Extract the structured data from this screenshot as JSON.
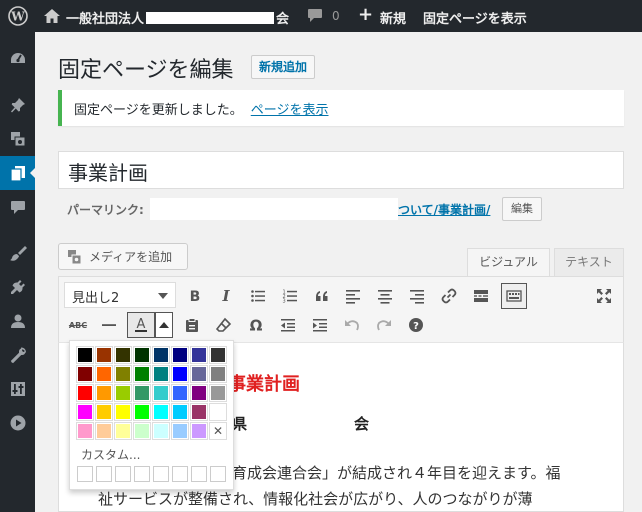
{
  "adminbar": {
    "site_prefix": "一般社団法人",
    "site_suffix": "会",
    "comment_count": "0",
    "new_label": "新規",
    "view_label": "固定ページを表示"
  },
  "page": {
    "title": "固定ページを編集",
    "add_new": "新規追加"
  },
  "notice": {
    "text": "固定ページを更新しました。",
    "link": "ページを表示"
  },
  "post": {
    "title": "事業計画",
    "permalink_label": "パーマリンク:",
    "permalink_tail": "ついて/事業計画/",
    "edit_button": "編集"
  },
  "editor": {
    "media_button": "メディアを追加",
    "tab_visual": "ビジュアル",
    "tab_text": "テキスト",
    "format_select": "見出し2",
    "strikethrough_label": "ABC"
  },
  "colors": {
    "accent": "#0073aa",
    "adminbar": "#23282d",
    "notice_success": "#46b450",
    "heading_red": "#e02020"
  },
  "content": {
    "heading": "事業計画",
    "sub1": "県",
    "sub2": "会",
    "line1": "育成会連合会」が結成され４年目を迎えます。福",
    "line2": "祉サービスが整備され、情報化社会が広がり、人のつながりが薄"
  },
  "color_picker": {
    "custom_label": "カスタム...",
    "clear_symbol": "✕",
    "swatches": [
      [
        "#000000",
        "#993300",
        "#333300",
        "#003300",
        "#003366",
        "#000080",
        "#333399",
        "#333333"
      ],
      [
        "#800000",
        "#FF6600",
        "#808000",
        "#008000",
        "#008080",
        "#0000FF",
        "#666699",
        "#808080"
      ],
      [
        "#FF0000",
        "#FF9900",
        "#99CC00",
        "#339966",
        "#33CCCC",
        "#3366FF",
        "#800080",
        "#999999"
      ],
      [
        "#FF00FF",
        "#FFCC00",
        "#FFFF00",
        "#00FF00",
        "#00FFFF",
        "#00CCFF",
        "#993366",
        "#FFFFFF"
      ],
      [
        "#FF99CC",
        "#FFCC99",
        "#FFFF99",
        "#CCFFCC",
        "#CCFFFF",
        "#99CCFF",
        "#CC99FF",
        ""
      ]
    ]
  }
}
